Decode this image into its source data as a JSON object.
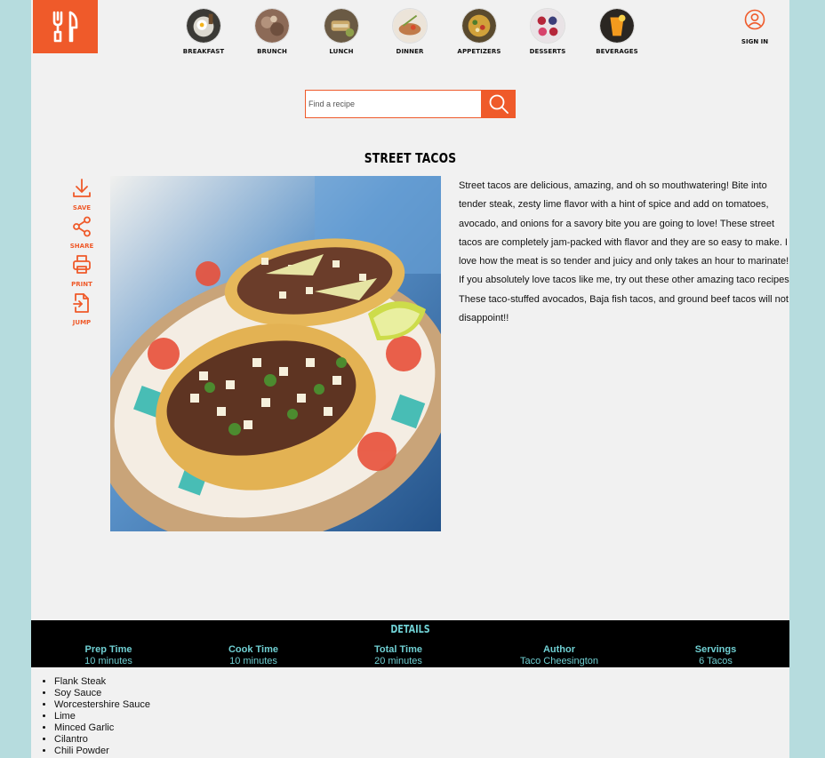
{
  "nav": {
    "categories": [
      {
        "label": "BREAKFAST"
      },
      {
        "label": "BRUNCH"
      },
      {
        "label": "LUNCH"
      },
      {
        "label": "DINNER"
      },
      {
        "label": "APPETIZERS"
      },
      {
        "label": "DESSERTS"
      },
      {
        "label": "BEVERAGES"
      }
    ],
    "signin_label": "SIGN IN"
  },
  "search": {
    "placeholder": "Find a recipe"
  },
  "recipe": {
    "title": "STREET TACOS",
    "description": "Street tacos are delicious, amazing, and oh so mouthwatering! Bite into tender steak, zesty lime flavor with a hint of spice and add on tomatoes, avocado, and onions for a savory bite you are going to love! These street tacos are completely jam-packed with flavor and they are so easy to make. I love how the meat is so tender and juicy and only takes an hour to marinate! If you absolutely love tacos like me, try out these other amazing taco recipes! These taco-stuffed avocados, Baja fish tacos, and ground beef tacos will not disappoint!!"
  },
  "actions": {
    "save": "SAVE",
    "share": "SHARE",
    "print": "PRINT",
    "jump": "JUMP"
  },
  "details": {
    "heading": "DETAILS",
    "items": [
      {
        "label": "Prep Time",
        "value": "10 minutes"
      },
      {
        "label": "Cook Time",
        "value": "10 minutes"
      },
      {
        "label": "Total Time",
        "value": "20 minutes"
      },
      {
        "label": "Author",
        "value": "Taco Cheesington"
      },
      {
        "label": "Servings",
        "value": "6 Tacos"
      }
    ]
  },
  "ingredients": [
    "Flank Steak",
    "Soy Sauce",
    "Worcestershire Sauce",
    "Lime",
    "Minced Garlic",
    "Cilantro",
    "Chili Powder"
  ],
  "colors": {
    "accent": "#ef5a2a",
    "teal": "#6fcfd2",
    "background": "#b6dcde"
  },
  "icons": [
    "utensils-logo-icon",
    "user-circle-icon",
    "search-icon",
    "download-icon",
    "share-icon",
    "printer-icon",
    "jump-icon"
  ]
}
